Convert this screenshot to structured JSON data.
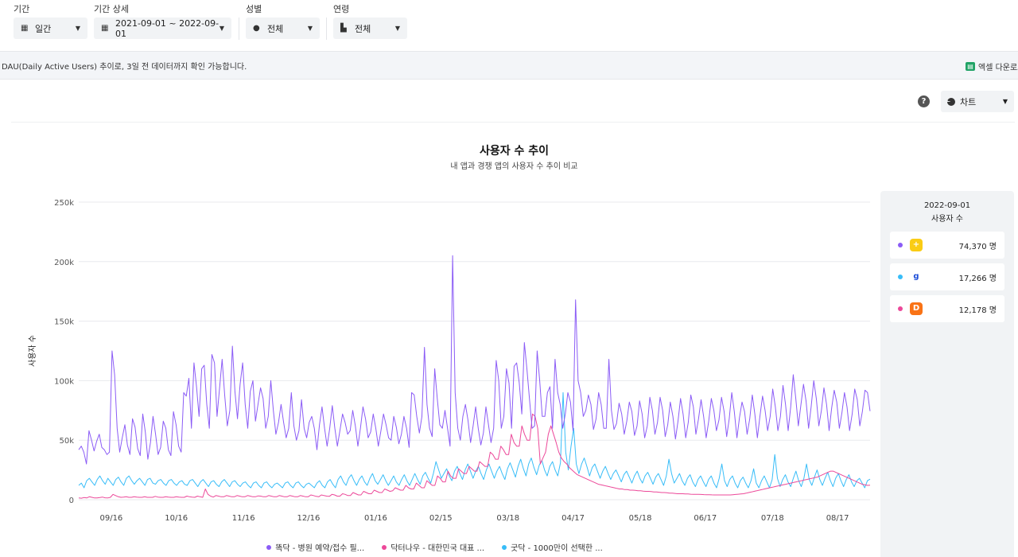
{
  "filters": [
    {
      "label": "기간",
      "value": "일간",
      "icon": "calendar-icon"
    },
    {
      "label": "기간 상세",
      "value": "2021-09-01 ~ 2022-09-01",
      "icon": "calendar-icon"
    },
    {
      "label": "성별",
      "value": "전체",
      "icon": "person-icon"
    },
    {
      "label": "연령",
      "value": "전체",
      "icon": "cake-icon"
    }
  ],
  "info_text": "DAU(Daily Active Users) 추이로, 3일 전 데이터까지 확인 가능합니다.",
  "excel_label": "엑셀 다운로드",
  "help_glyph": "?",
  "view_select": "차트",
  "chart_data": {
    "type": "line",
    "title": "사용자 수 추이",
    "subtitle": "내 앱과 경쟁 앱의 사용자 수 추이 비교",
    "ylabel": "사용자 수",
    "xlabel": "",
    "ylim": [
      0,
      250000
    ],
    "yticks": [
      "0",
      "50k",
      "100k",
      "150k",
      "200k",
      "250k"
    ],
    "x_range": [
      "2021-09-01",
      "2022-09-01"
    ],
    "xticks": [
      "09/16",
      "10/16",
      "11/16",
      "12/16",
      "01/16",
      "02/15",
      "03/18",
      "04/17",
      "05/18",
      "06/17",
      "07/18",
      "08/17"
    ],
    "grid": true,
    "legend_position": "bottom",
    "series": [
      {
        "name": "똑닥 - 병원 예약/접수 필...",
        "color": "#8b5cf6",
        "values": [
          42000,
          45000,
          40000,
          30000,
          58000,
          50000,
          41000,
          49000,
          55000,
          44000,
          42000,
          38000,
          40000,
          125000,
          105000,
          60000,
          40000,
          52000,
          63000,
          46000,
          38000,
          68000,
          61000,
          43000,
          37000,
          72000,
          57000,
          34000,
          48000,
          70000,
          55000,
          38000,
          44000,
          66000,
          60000,
          42000,
          37000,
          74000,
          63000,
          45000,
          40000,
          90000,
          87000,
          102000,
          60000,
          115000,
          95000,
          70000,
          110000,
          113000,
          80000,
          60000,
          122000,
          115000,
          70000,
          94000,
          118000,
          88000,
          62000,
          75000,
          129000,
          91000,
          68000,
          97000,
          115000,
          80000,
          60000,
          91000,
          100000,
          66000,
          80000,
          94000,
          85000,
          60000,
          70000,
          100000,
          75000,
          55000,
          65000,
          80000,
          65000,
          52000,
          60000,
          90000,
          62000,
          50000,
          58000,
          84000,
          60000,
          52000,
          65000,
          70000,
          60000,
          42000,
          63000,
          78000,
          60000,
          45000,
          60000,
          79000,
          60000,
          45000,
          58000,
          72000,
          65000,
          55000,
          58000,
          75000,
          62000,
          45000,
          60000,
          78000,
          68000,
          52000,
          57000,
          72000,
          60000,
          45000,
          58000,
          72000,
          63000,
          52000,
          50000,
          70000,
          61000,
          47000,
          55000,
          70000,
          60000,
          44000,
          90000,
          88000,
          70000,
          56000,
          70000,
          128000,
          80000,
          60000,
          53000,
          110000,
          85000,
          63000,
          60000,
          75000,
          60000,
          45000,
          205000,
          90000,
          60000,
          50000,
          70000,
          80000,
          67000,
          48000,
          62000,
          78000,
          60000,
          46000,
          56000,
          78000,
          63000,
          48000,
          60000,
          117000,
          100000,
          60000,
          70000,
          110000,
          98000,
          60000,
          112000,
          115000,
          98000,
          72000,
          132000,
          110000,
          85000,
          60000,
          62000,
          125000,
          100000,
          70000,
          70000,
          90000,
          95000,
          60000,
          118000,
          90000,
          80000,
          60000,
          72000,
          90000,
          82000,
          58000,
          168000,
          100000,
          90000,
          70000,
          75000,
          88000,
          80000,
          59000,
          68000,
          90000,
          80000,
          60000,
          60000,
          118000,
          75000,
          59000,
          64000,
          81000,
          72000,
          55000,
          66000,
          82000,
          74000,
          54000,
          62000,
          83000,
          72000,
          52000,
          62000,
          86000,
          75000,
          55000,
          65000,
          86000,
          75000,
          53000,
          63000,
          82000,
          70000,
          51000,
          66000,
          85000,
          72000,
          52000,
          65000,
          88000,
          78000,
          55000,
          68000,
          84000,
          70000,
          52000,
          66000,
          85000,
          75000,
          58000,
          67000,
          86000,
          74000,
          53000,
          68000,
          90000,
          74000,
          52000,
          69000,
          82000,
          74000,
          55000,
          68000,
          88000,
          72000,
          52000,
          70000,
          87000,
          75000,
          58000,
          70000,
          93000,
          78000,
          58000,
          70000,
          96000,
          80000,
          58000,
          78000,
          105000,
          85000,
          62000,
          80000,
          97000,
          83000,
          60000,
          78000,
          100000,
          85000,
          62000,
          75000,
          94000,
          80000,
          58000,
          77000,
          92000,
          82000,
          60000,
          73000,
          90000,
          78000,
          58000,
          72000,
          93000,
          84000,
          62000,
          74000,
          92000,
          90000,
          74370
        ]
      },
      {
        "name": "닥터나우 - 대한민국 대표 ...",
        "color": "#ec4899",
        "values": [
          1500,
          1300,
          1800,
          1500,
          2500,
          2000,
          1500,
          1500,
          1800,
          2200,
          1600,
          1500,
          2000,
          4500,
          3500,
          2500,
          2000,
          2200,
          2500,
          2000,
          2000,
          2500,
          2200,
          2000,
          2000,
          2500,
          2000,
          2000,
          2000,
          2800,
          2200,
          2000,
          2000,
          2500,
          2200,
          2000,
          2000,
          2500,
          2200,
          2000,
          2000,
          3000,
          2500,
          2200,
          2000,
          3000,
          2500,
          2000,
          9000,
          4500,
          3000,
          2200,
          3500,
          3000,
          2500,
          2500,
          3500,
          3000,
          2500,
          2500,
          3500,
          3000,
          2500,
          2500,
          3500,
          3000,
          2500,
          2500,
          3200,
          3000,
          2500,
          2500,
          3500,
          3000,
          2500,
          2500,
          3500,
          3000,
          2500,
          2500,
          3500,
          3000,
          2500,
          2500,
          3500,
          3000,
          2500,
          2500,
          4000,
          3500,
          2800,
          2500,
          4000,
          3500,
          3000,
          2800,
          4500,
          4000,
          3000,
          3000,
          5000,
          4500,
          3500,
          3500,
          6000,
          5000,
          4000,
          4000,
          7000,
          6000,
          5000,
          5000,
          8000,
          7000,
          6000,
          6000,
          9000,
          8000,
          7000,
          7500,
          10000,
          9000,
          8000,
          8000,
          12000,
          10000,
          9000,
          9000,
          14000,
          12000,
          10000,
          10000,
          16000,
          14000,
          12000,
          12000,
          20000,
          18000,
          15000,
          15000,
          24000,
          20000,
          18000,
          18000,
          26000,
          24000,
          22000,
          22000,
          28000,
          26000,
          24000,
          24000,
          32000,
          30000,
          28000,
          28000,
          40000,
          38000,
          34000,
          34000,
          45000,
          42000,
          38000,
          38000,
          55000,
          48000,
          45000,
          45000,
          62000,
          55000,
          50000,
          50000,
          72000,
          70000,
          60000,
          30000,
          35000,
          40000,
          55000,
          62000,
          55000,
          48000,
          40000,
          35000,
          32000,
          30000,
          27000,
          25000,
          23000,
          21000,
          20000,
          19000,
          18000,
          17000,
          16000,
          15000,
          14000,
          13000,
          12500,
          12000,
          11500,
          11000,
          10500,
          10000,
          9500,
          9000,
          9000,
          8500,
          8500,
          8000,
          8000,
          7800,
          7500,
          7500,
          7200,
          7000,
          7000,
          6800,
          6500,
          6500,
          6300,
          6000,
          6000,
          5800,
          5500,
          5500,
          5300,
          5000,
          5000,
          5000,
          4800,
          4800,
          4600,
          4500,
          4500,
          4500,
          4400,
          4300,
          4200,
          4200,
          4100,
          4000,
          4000,
          4000,
          4000,
          4000,
          4000,
          4000,
          4200,
          4400,
          4600,
          4800,
          5000,
          5500,
          6000,
          6500,
          7000,
          7500,
          8000,
          8500,
          9000,
          9500,
          10000,
          10500,
          11000,
          11500,
          12000,
          12500,
          13000,
          13500,
          14000,
          14500,
          15000,
          15500,
          16000,
          16500,
          17000,
          17500,
          18000,
          18500,
          19000,
          20000,
          21000,
          22000,
          23000,
          24000,
          24000,
          23000,
          22000,
          21000,
          20000,
          19000,
          18000,
          17000,
          16000,
          15000,
          14000,
          13000,
          12500,
          12000,
          12178
        ]
      },
      {
        "name": "굿닥 - 1000만이 선택한 ...",
        "color": "#38bdf8",
        "values": [
          12000,
          14000,
          10000,
          16000,
          18000,
          15000,
          12000,
          17000,
          20000,
          16000,
          13000,
          18000,
          15000,
          12000,
          17000,
          19000,
          15000,
          12000,
          18000,
          20000,
          16000,
          13000,
          16000,
          18000,
          15000,
          12000,
          17000,
          18000,
          14000,
          13000,
          16000,
          17000,
          14000,
          12000,
          16000,
          17000,
          14000,
          12000,
          15000,
          16000,
          13000,
          12000,
          16000,
          17000,
          14000,
          11000,
          15000,
          17000,
          14000,
          11000,
          15000,
          16000,
          13000,
          11000,
          15000,
          17000,
          14000,
          11000,
          15000,
          16000,
          13000,
          11000,
          14000,
          15000,
          12000,
          10000,
          14000,
          15000,
          12000,
          10000,
          14000,
          15000,
          12000,
          10000,
          13000,
          14000,
          12000,
          10000,
          14000,
          15000,
          12000,
          10000,
          14000,
          15000,
          12000,
          10000,
          13000,
          14000,
          12000,
          10000,
          14000,
          16000,
          12000,
          10000,
          15000,
          17000,
          13000,
          10000,
          17000,
          20000,
          15000,
          12000,
          18000,
          21000,
          16000,
          12000,
          17000,
          20000,
          15000,
          12000,
          18000,
          22000,
          16000,
          13000,
          17000,
          21000,
          16000,
          12000,
          16000,
          20000,
          15000,
          12000,
          17000,
          21000,
          16000,
          12000,
          17000,
          22000,
          17000,
          13000,
          20000,
          23000,
          18000,
          14000,
          22000,
          32000,
          25000,
          18000,
          22000,
          26000,
          20000,
          16000,
          24000,
          28000,
          22000,
          17000,
          25000,
          30000,
          24000,
          18000,
          24000,
          28000,
          22000,
          17000,
          25000,
          30000,
          24000,
          18000,
          24000,
          28000,
          22000,
          17000,
          26000,
          31000,
          25000,
          19000,
          28000,
          34000,
          26000,
          20000,
          30000,
          35000,
          27000,
          21000,
          29000,
          33000,
          25000,
          20000,
          28000,
          32000,
          25000,
          20000,
          31000,
          90000,
          40000,
          25000,
          45000,
          60000,
          30000,
          22000,
          30000,
          35000,
          28000,
          20000,
          27000,
          30000,
          24000,
          18000,
          24000,
          28000,
          22000,
          17000,
          22000,
          25000,
          20000,
          15000,
          21000,
          24000,
          19000,
          14000,
          20000,
          24000,
          18000,
          14000,
          20000,
          23000,
          18000,
          13000,
          19000,
          22000,
          17000,
          12000,
          20000,
          34000,
          22000,
          14000,
          18000,
          22000,
          16000,
          12000,
          18000,
          21000,
          15000,
          11000,
          17000,
          20000,
          15000,
          11000,
          17000,
          20000,
          14000,
          10000,
          18000,
          30000,
          16000,
          11000,
          17000,
          20000,
          14000,
          10000,
          16000,
          19000,
          14000,
          10000,
          16000,
          26000,
          14000,
          10000,
          16000,
          20000,
          15000,
          10000,
          17000,
          38000,
          18000,
          11000,
          17000,
          21000,
          15000,
          11000,
          18000,
          24000,
          16000,
          11000,
          18000,
          30000,
          17000,
          12000,
          19000,
          25000,
          17000,
          12000,
          18000,
          23000,
          16000,
          11000,
          18000,
          22000,
          16000,
          11000,
          17000,
          21000,
          15000,
          11000,
          16000,
          18000,
          14000,
          10000,
          16000,
          17266
        ]
      }
    ]
  },
  "side_panel": {
    "date": "2022-09-01",
    "label": "사용자 수",
    "entries": [
      {
        "value": "74,370 명",
        "color": "#8b5cf6",
        "icon": "ddocdoc-app-icon",
        "icon_color": "#facc15",
        "glyph": "+"
      },
      {
        "value": "17,266 명",
        "color": "#38bdf8",
        "icon": "goodoc-app-icon",
        "icon_color": "#ffffff",
        "glyph": "g"
      },
      {
        "value": "12,178 명",
        "color": "#ec4899",
        "icon": "doctornow-app-icon",
        "icon_color": "#f97316",
        "glyph": "D"
      }
    ]
  }
}
